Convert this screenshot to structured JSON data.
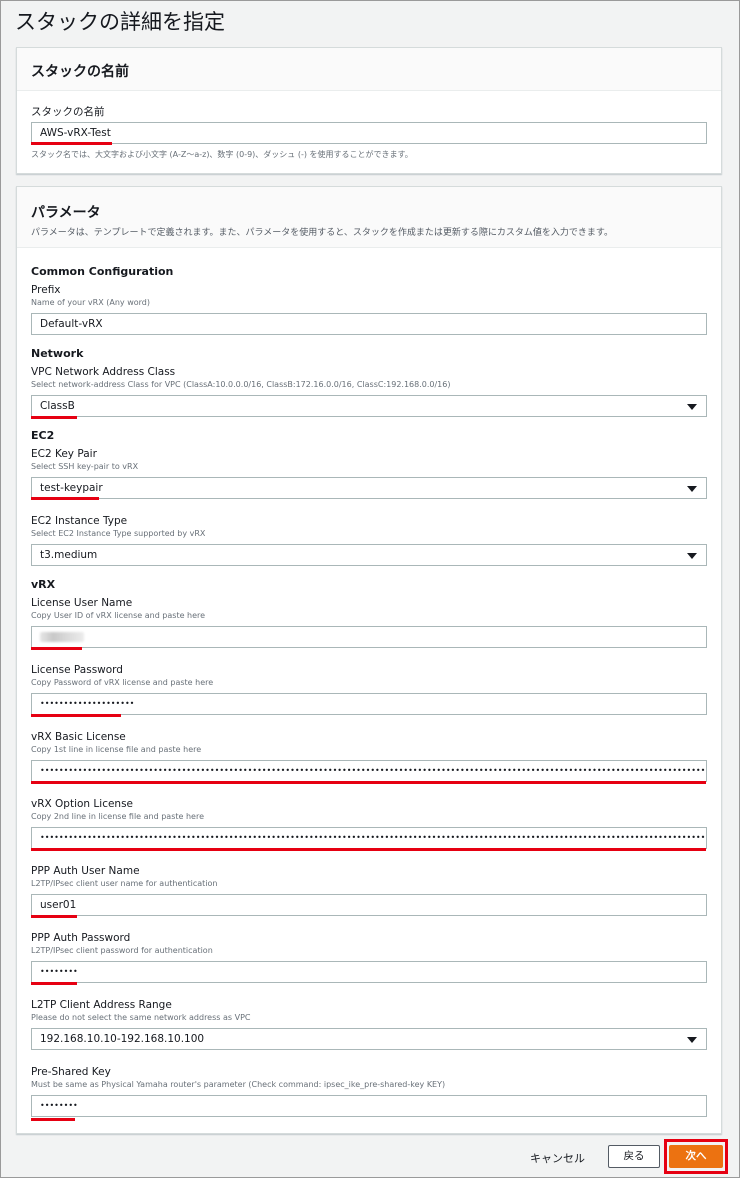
{
  "page": {
    "title": "スタックの詳細を指定"
  },
  "stack_name_panel": {
    "title": "スタックの名前",
    "label": "スタックの名前",
    "value": "AWS-vRX-Test",
    "hint": "スタック名では、大文字および小文字 (A-Z〜a-z)、数字 (0-9)、ダッシュ (-) を使用することができます。"
  },
  "params_panel": {
    "title": "パラメータ",
    "description": "パラメータは、テンプレートで定義されます。また、パラメータを使用すると、スタックを作成または更新する際にカスタム値を入力できます。",
    "groups": {
      "common": "Common Configuration",
      "network": "Network",
      "ec2": "EC2",
      "vrx": "vRX"
    },
    "fields": {
      "prefix": {
        "label": "Prefix",
        "desc": "Name of your vRX (Any word)",
        "value": "Default-vRX"
      },
      "vpc_class": {
        "label": "VPC Network Address Class",
        "desc": "Select network-address Class for VPC (ClassA:10.0.0.0/16, ClassB:172.16.0.0/16, ClassC:192.168.0.0/16)",
        "value": "ClassB"
      },
      "key_pair": {
        "label": "EC2 Key Pair",
        "desc": "Select SSH key-pair to vRX",
        "value": "test-keypair"
      },
      "instance_type": {
        "label": "EC2 Instance Type",
        "desc": "Select EC2 Instance Type supported by vRX",
        "value": "t3.medium"
      },
      "license_user": {
        "label": "License User Name",
        "desc": "Copy User ID of vRX license and paste here"
      },
      "license_password": {
        "label": "License Password",
        "desc": "Copy Password of vRX license and paste here",
        "value": "••••••••••••••••••••"
      },
      "basic_license": {
        "label": "vRX Basic License",
        "desc": "Copy 1st line in license file and paste here",
        "value": "••••••••••••••••••••••••••••••••••••••••••••••••••••••••••••••••••••••••••••••••••••••••••••••••••••••••••••••••••••••••••••••••••••••••••••••••••••••••••••••••••••••••••••••••••••••••••••••••••••••••••••••••••"
      },
      "option_license": {
        "label": "vRX Option License",
        "desc": "Copy 2nd line in license file and paste here",
        "value": "••••••••••••••••••••••••••••••••••••••••••••••••••••••••••••••••••••••••••••••••••••••••••••••••••••••••••••••••••••••••••••••••••••••••••••••••••••••••••••••••••••••••••••••••••••••••••••••••••••••••••••••••••"
      },
      "ppp_user": {
        "label": "PPP Auth User Name",
        "desc": "L2TP/IPsec client user name for authentication",
        "value": "user01"
      },
      "ppp_password": {
        "label": "PPP Auth Password",
        "desc": "L2TP/IPsec client password for authentication",
        "value": "••••••••"
      },
      "l2tp_range": {
        "label": "L2TP Client Address Range",
        "desc": "Please do not select the same network address as VPC",
        "value": "192.168.10.10-192.168.10.100"
      },
      "psk": {
        "label": "Pre-Shared Key",
        "desc": "Must be same as Physical Yamaha router's parameter (Check command: ipsec_ike_pre-shared-key KEY)",
        "value": "••••••••"
      }
    }
  },
  "footer": {
    "cancel": "キャンセル",
    "back": "戻る",
    "next": "次へ"
  },
  "colors": {
    "primary": "#ec7211",
    "annotation_red": "#e60012"
  },
  "icons": {
    "select_caret": "caret-down-icon"
  }
}
